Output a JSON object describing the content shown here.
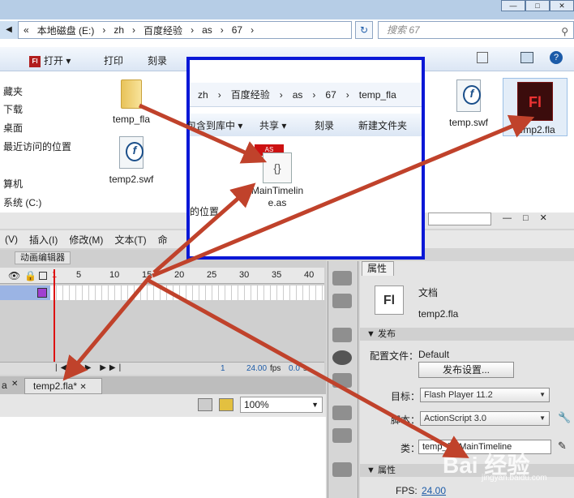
{
  "explorer": {
    "address_crumbs": [
      "«",
      "本地磁盘 (E:)",
      "›",
      "zh",
      "›",
      "百度经验",
      "›",
      "as",
      "›",
      "67",
      "›"
    ],
    "search_placeholder": "搜索 67",
    "toolbar": {
      "open": "打开",
      "print": "打印",
      "burn": "刻录"
    },
    "sidebar": [
      "藏夹",
      "下载",
      "桌面",
      "最近访问的位置",
      "算机",
      "系统 (C:)"
    ],
    "files": {
      "folder": "temp_fla",
      "swf1": "temp.swf",
      "swf2": "temp2.swf",
      "fla": "temp2.fla"
    }
  },
  "overlay": {
    "crumbs": [
      "zh",
      "›",
      "百度经验",
      "›",
      "as",
      "›",
      "67",
      "›",
      "temp_fla"
    ],
    "toolbar": {
      "include": "包含到库中",
      "share": "共享",
      "burn": "刻录",
      "new_folder": "新建文件夹"
    },
    "file_name": "MainTimeline.as",
    "left_label": "的位置",
    "as_tag": "AS"
  },
  "flash": {
    "menu": [
      "(V)",
      "插入(I)",
      "修改(M)",
      "文本(T)",
      "命"
    ],
    "timeline_tab": "动画编辑器",
    "ruler": [
      "1",
      "5",
      "10",
      "15",
      "20",
      "25",
      "30",
      "35",
      "40"
    ],
    "timeline_footer": {
      "frame": "1",
      "fps": "24.00",
      "fps_unit": "fps",
      "time": "0.0",
      "time_unit": "s"
    },
    "doc_tab": "temp2.fla*",
    "doc_tab_prefix": "a",
    "zoom": "100%"
  },
  "properties": {
    "tab": "属性",
    "doc_type": "文档",
    "doc_name": "temp2.fla",
    "icon_text": "Fl",
    "publish_section": "发布",
    "profile_label": "配置文件：",
    "profile_value": "Default",
    "publish_settings_btn": "发布设置...",
    "target_label": "目标：",
    "target_value": "Flash Player 11.2",
    "script_label": "脚本：",
    "script_value": "ActionScript 3.0",
    "class_label": "类：",
    "class_value": "temp_fla.MainTimeline",
    "props_section": "属性",
    "fps_label": "FPS:",
    "fps_value": "24.00"
  },
  "watermark": {
    "brand": "Bai 经验",
    "url": "jingyan.baidu.com"
  },
  "colors": {
    "annotation_arrow": "#c0422b",
    "overlay_border": "#0a18d6"
  }
}
